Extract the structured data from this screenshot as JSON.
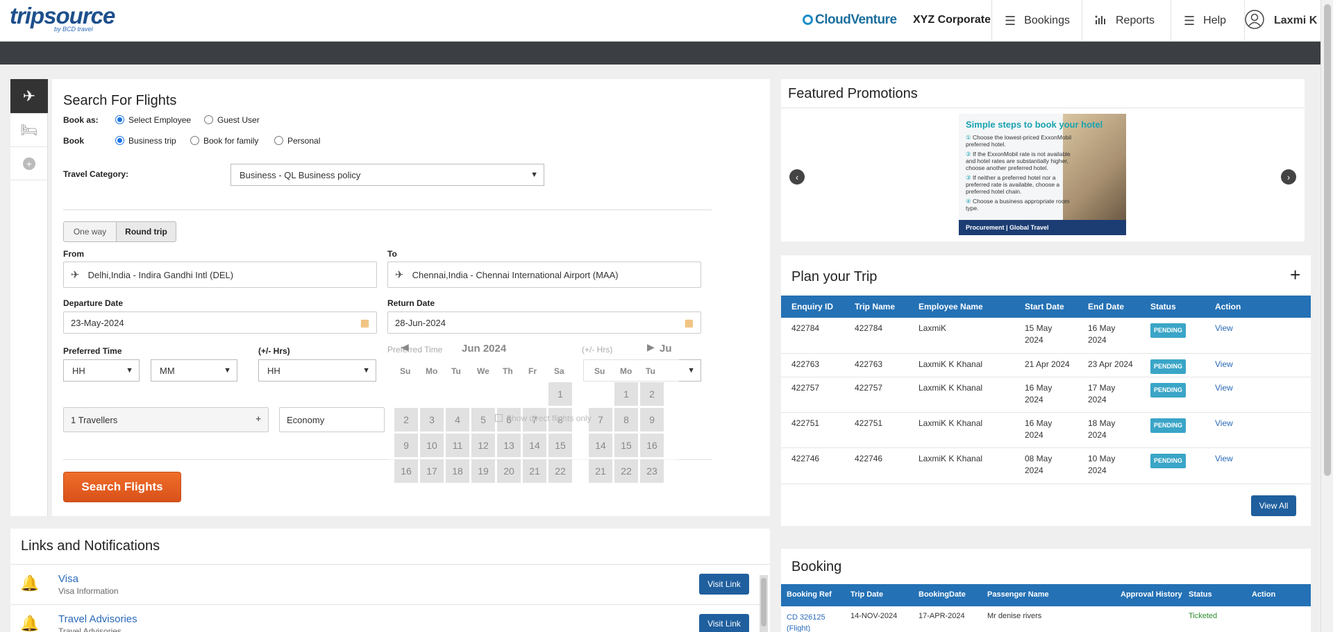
{
  "header": {
    "logo": "tripsource",
    "logo_sub": "by BCD travel",
    "brand": "CloudVenture",
    "corporate": "XYZ Corporate",
    "nav": [
      {
        "label": "Bookings",
        "icon": "menu-icon"
      },
      {
        "label": "Reports",
        "icon": "bar-chart-icon"
      },
      {
        "label": "Help",
        "icon": "menu-icon"
      }
    ],
    "user": "Laxmi K"
  },
  "search": {
    "title": "Search For Flights",
    "book_as_label": "Book as:",
    "book_as_options": [
      "Select Employee",
      "Guest User"
    ],
    "book_label": "Book",
    "book_options": [
      "Business trip",
      "Book for family",
      "Personal"
    ],
    "travel_category_label": "Travel Category:",
    "travel_category_value": "Business - QL Business policy",
    "trip_types": [
      "One way",
      "Round trip"
    ],
    "from_label": "From",
    "from_value": "Delhi,India - Indira Gandhi Intl (DEL)",
    "to_label": "To",
    "to_value": "Chennai,India - Chennai International Airport (MAA)",
    "departure_label": "Departure Date",
    "departure_value": "23-May-2024",
    "return_label": "Return Date",
    "return_value": "28-Jun-2024",
    "preferred_time_label": "Preferred Time",
    "plusminus_label": "(+/- Hrs)",
    "hh": "HH",
    "mm": "MM",
    "travellers": "1 Travellers",
    "cabin": "Economy",
    "direct_only": "Show direct flights only",
    "search_button": "Search Flights"
  },
  "calendar": {
    "month": "Jun 2024",
    "next_month": "Ju",
    "days": [
      "Su",
      "Mo",
      "Tu",
      "We",
      "Th",
      "Fr",
      "Sa"
    ],
    "rows": [
      [
        "",
        "",
        "",
        "",
        "",
        "",
        "1"
      ],
      [
        "2",
        "3",
        "4",
        "5",
        "6",
        "7",
        "8"
      ],
      [
        "9",
        "10",
        "11",
        "12",
        "13",
        "14",
        "15"
      ],
      [
        "16",
        "17",
        "18",
        "19",
        "20",
        "21",
        "22"
      ]
    ],
    "next_rows": [
      [
        "",
        "1",
        "2"
      ],
      [
        "7",
        "8",
        "9"
      ],
      [
        "14",
        "15",
        "16"
      ],
      [
        "21",
        "22",
        "23"
      ]
    ]
  },
  "promotions": {
    "title": "Featured Promotions",
    "promo_heading": "Simple steps to book your hotel",
    "promo_steps": [
      "Choose the lowest-priced ExxonMobil preferred hotel.",
      "If the ExxonMobil rate is not available and hotel rates are substantially higher, choose another preferred hotel.",
      "If neither a preferred hotel nor a preferred rate is available, choose a preferred hotel chain.",
      "Choose a business appropriate room type."
    ],
    "promo_footer": "Procurement | Global Travel"
  },
  "plan": {
    "title": "Plan your Trip",
    "columns": [
      "Enquiry ID",
      "Trip Name",
      "Employee Name",
      "Start Date",
      "End Date",
      "Status",
      "Action"
    ],
    "rows": [
      {
        "id": "422784",
        "trip": "422784",
        "name": "LaxmiK",
        "start": "15 May 2024",
        "end": "16 May 2024",
        "status": "PENDING",
        "action": "View"
      },
      {
        "id": "422763",
        "trip": "422763",
        "name": "LaxmiK K Khanal",
        "start": "21 Apr 2024",
        "end": "23 Apr 2024",
        "status": "PENDING",
        "action": "View"
      },
      {
        "id": "422757",
        "trip": "422757",
        "name": "LaxmiK K Khanal",
        "start": "16 May 2024",
        "end": "17 May 2024",
        "status": "PENDING",
        "action": "View"
      },
      {
        "id": "422751",
        "trip": "422751",
        "name": "LaxmiK K Khanal",
        "start": "16 May 2024",
        "end": "18 May 2024",
        "status": "PENDING",
        "action": "View"
      },
      {
        "id": "422746",
        "trip": "422746",
        "name": "LaxmiK K Khanal",
        "start": "08 May 2024",
        "end": "10 May 2024",
        "status": "PENDING",
        "action": "View"
      }
    ],
    "view_all": "View All"
  },
  "links": {
    "title": "Links and Notifications",
    "items": [
      {
        "title": "Visa",
        "subtitle": "Visa Information",
        "button": "Visit Link"
      },
      {
        "title": "Travel Advisories",
        "subtitle": "Travel Advisories",
        "button": "Visit Link"
      }
    ]
  },
  "booking": {
    "title": "Booking",
    "columns": [
      "Booking Ref",
      "Trip Date",
      "BookingDate",
      "Passenger Name",
      "Approval History",
      "Status",
      "Action"
    ],
    "rows": [
      {
        "ref": "CD 326125",
        "ref_type": "(Flight)",
        "trip_date": "14-NOV-2024",
        "booking_date": "17-APR-2024",
        "passenger": "Mr denise rivers",
        "status": "Ticketed"
      }
    ]
  },
  "colors": {
    "accent": "#2471b5",
    "search_button": "#e0581e",
    "badge": "#3aa5c7",
    "ticketed": "#2e8b2e"
  }
}
